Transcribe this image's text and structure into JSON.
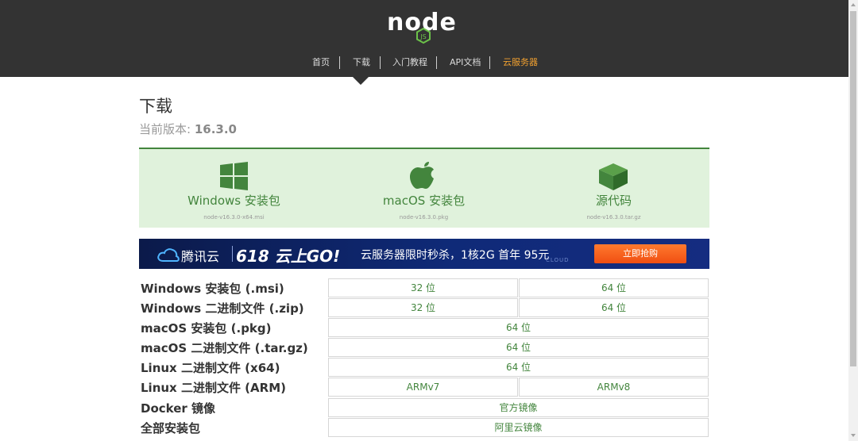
{
  "header": {
    "logo_text": "node",
    "logo_badge": "JS",
    "nav": [
      {
        "label": "首页",
        "active": false
      },
      {
        "label": "下载",
        "active": false
      },
      {
        "label": "入门教程",
        "active": false
      },
      {
        "label": "API文档",
        "active": false
      },
      {
        "label": "云服务器",
        "active": true
      }
    ],
    "colors": {
      "bar": "#333333",
      "active": "#f0a030",
      "accent": "#43853d"
    }
  },
  "main": {
    "title": "下载",
    "version_prefix": "当前版本: ",
    "version": "16.3.0",
    "downloads": [
      {
        "icon": "windows-icon",
        "label": "Windows 安装包",
        "file": "node-v16.3.0-x64.msi"
      },
      {
        "icon": "apple-icon",
        "label": "macOS 安装包",
        "file": "node-v16.3.0.pkg"
      },
      {
        "icon": "cube-icon",
        "label": "源代码",
        "file": "node-v16.3.0.tar.gz"
      }
    ]
  },
  "banner": {
    "brand": "腾讯云",
    "headline": "618 云上GO!",
    "offer": "云服务器限时秒杀，1核2G 首年 95元",
    "tag": "CLOUD",
    "button": "立即抢购"
  },
  "table": {
    "rows": [
      {
        "label": "Windows 安装包 (.msi)",
        "cells": [
          "32 位",
          "64 位"
        ]
      },
      {
        "label": "Windows 二进制文件 (.zip)",
        "cells": [
          "32 位",
          "64 位"
        ]
      },
      {
        "label": "macOS 安装包 (.pkg)",
        "cells": [
          "64 位"
        ]
      },
      {
        "label": "macOS 二进制文件 (.tar.gz)",
        "cells": [
          "64 位"
        ]
      },
      {
        "label": "Linux 二进制文件 (x64)",
        "cells": [
          "64 位"
        ]
      },
      {
        "label": "Linux 二进制文件 (ARM)",
        "cells": [
          "ARMv7",
          "ARMv8"
        ]
      },
      {
        "label": "Docker 镜像",
        "cells": [
          "官方镜像"
        ]
      },
      {
        "label": "全部安装包",
        "cells": [
          "阿里云镜像"
        ]
      }
    ]
  }
}
